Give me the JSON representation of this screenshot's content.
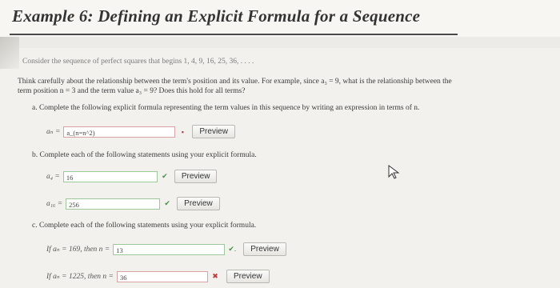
{
  "title": "Example 6: Defining an Explicit Formula for a Sequence",
  "intro": "Consider the sequence of perfect squares that begins 1, 4, 9, 16, 25, 36, . . . .",
  "think_line1": "Think carefully about the relationship between the term's position and its value. For example, since a₃ = 9, what is the relationship between the",
  "think_line2": "term position n = 3 and the term value a₃ = 9? Does this hold for all terms?",
  "part_a": {
    "prompt": "a. Complete the following explicit formula representing the term values in this sequence by writing an expression in terms of n.",
    "label": "aₙ =",
    "value": "a_(n=n^2)",
    "mark": "▪",
    "preview": "Preview"
  },
  "part_b": {
    "prompt": "b. Complete each of the following statements using your explicit formula.",
    "items": [
      {
        "label": "a₄ =",
        "value": "16",
        "mark": "✔",
        "preview": "Preview"
      },
      {
        "label": "a₁₆ =",
        "value": "256",
        "mark": "✔",
        "preview": "Preview"
      }
    ]
  },
  "part_c": {
    "prompt": "c. Complete each of the following statements using your explicit formula.",
    "items": [
      {
        "label": "If aₙ = 169, then n =",
        "value": "13",
        "mark": "✔.",
        "preview": "Preview"
      },
      {
        "label": "If aₙ = 1225, then n =",
        "value": "36",
        "mark": "✖",
        "preview": "Preview"
      }
    ]
  }
}
